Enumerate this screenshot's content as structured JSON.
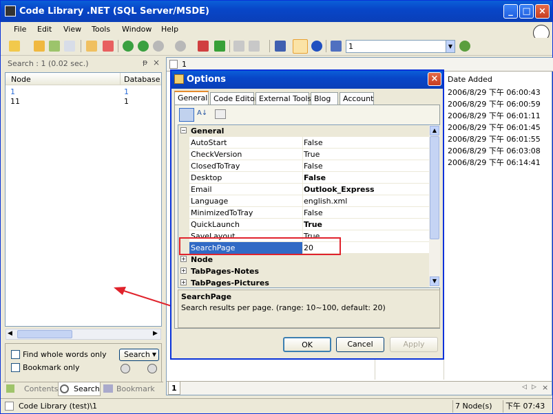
{
  "window": {
    "title": "Code Library .NET (SQL Server/MSDE)"
  },
  "menu": [
    "File",
    "Edit",
    "View",
    "Tools",
    "Window",
    "Help"
  ],
  "toolbar": {
    "combo_value": "1"
  },
  "left_pane": {
    "header": "Search : 1 (0.02 sec.)",
    "pin": "ᵽ",
    "close": "×",
    "columns": [
      "Node",
      "Database"
    ],
    "rows": [
      {
        "node": "1",
        "database": "1"
      },
      {
        "node": "11",
        "database": "1"
      }
    ],
    "find_whole_words": "Find whole words only",
    "bookmark_only": "Bookmark only",
    "search_button": "Search",
    "tabs": [
      "Contents",
      "Search",
      "Bookmark"
    ]
  },
  "right_pane": {
    "doc_tab": "1",
    "column_date": "Date Added",
    "dates": [
      "2006/8/29 下午 06:00:43",
      "2006/8/29 下午 06:00:59",
      "2006/8/29 下午 06:01:11",
      "2006/8/29 下午 06:01:45",
      "2006/8/29 下午 06:01:55",
      "2006/8/29 下午 06:03:08",
      "2006/8/29 下午 06:14:41"
    ],
    "bottom_tab": "1"
  },
  "dialog": {
    "title": "Options",
    "tabs": [
      "General",
      "Code Editor",
      "External Tools",
      "Blog",
      "Account"
    ],
    "categories": {
      "general": "General",
      "node": "Node",
      "tabpages_notes": "TabPages-Notes",
      "tabpages_pictures": "TabPages-Pictures"
    },
    "properties": [
      {
        "key": "AutoStart",
        "value": "False",
        "bold": false
      },
      {
        "key": "CheckVersion",
        "value": "True",
        "bold": false
      },
      {
        "key": "ClosedToTray",
        "value": "False",
        "bold": false
      },
      {
        "key": "Desktop",
        "value": "False",
        "bold": true
      },
      {
        "key": "Email",
        "value": "Outlook_Express",
        "bold": true
      },
      {
        "key": "Language",
        "value": "english.xml",
        "bold": false
      },
      {
        "key": "MinimizedToTray",
        "value": "False",
        "bold": false
      },
      {
        "key": "QuickLaunch",
        "value": "True",
        "bold": true
      },
      {
        "key": "SaveLayout",
        "value": "True",
        "bold": false
      },
      {
        "key": "SearchPage",
        "value": "20",
        "bold": false
      }
    ],
    "description_title": "SearchPage",
    "description_text": "Search results per page. (range: 10~100, default: 20)",
    "ok": "OK",
    "cancel": "Cancel",
    "apply": "Apply"
  },
  "status": {
    "left": "Code Library (test)\\1",
    "nodes": "7 Node(s)",
    "time": "下午 07:43"
  }
}
